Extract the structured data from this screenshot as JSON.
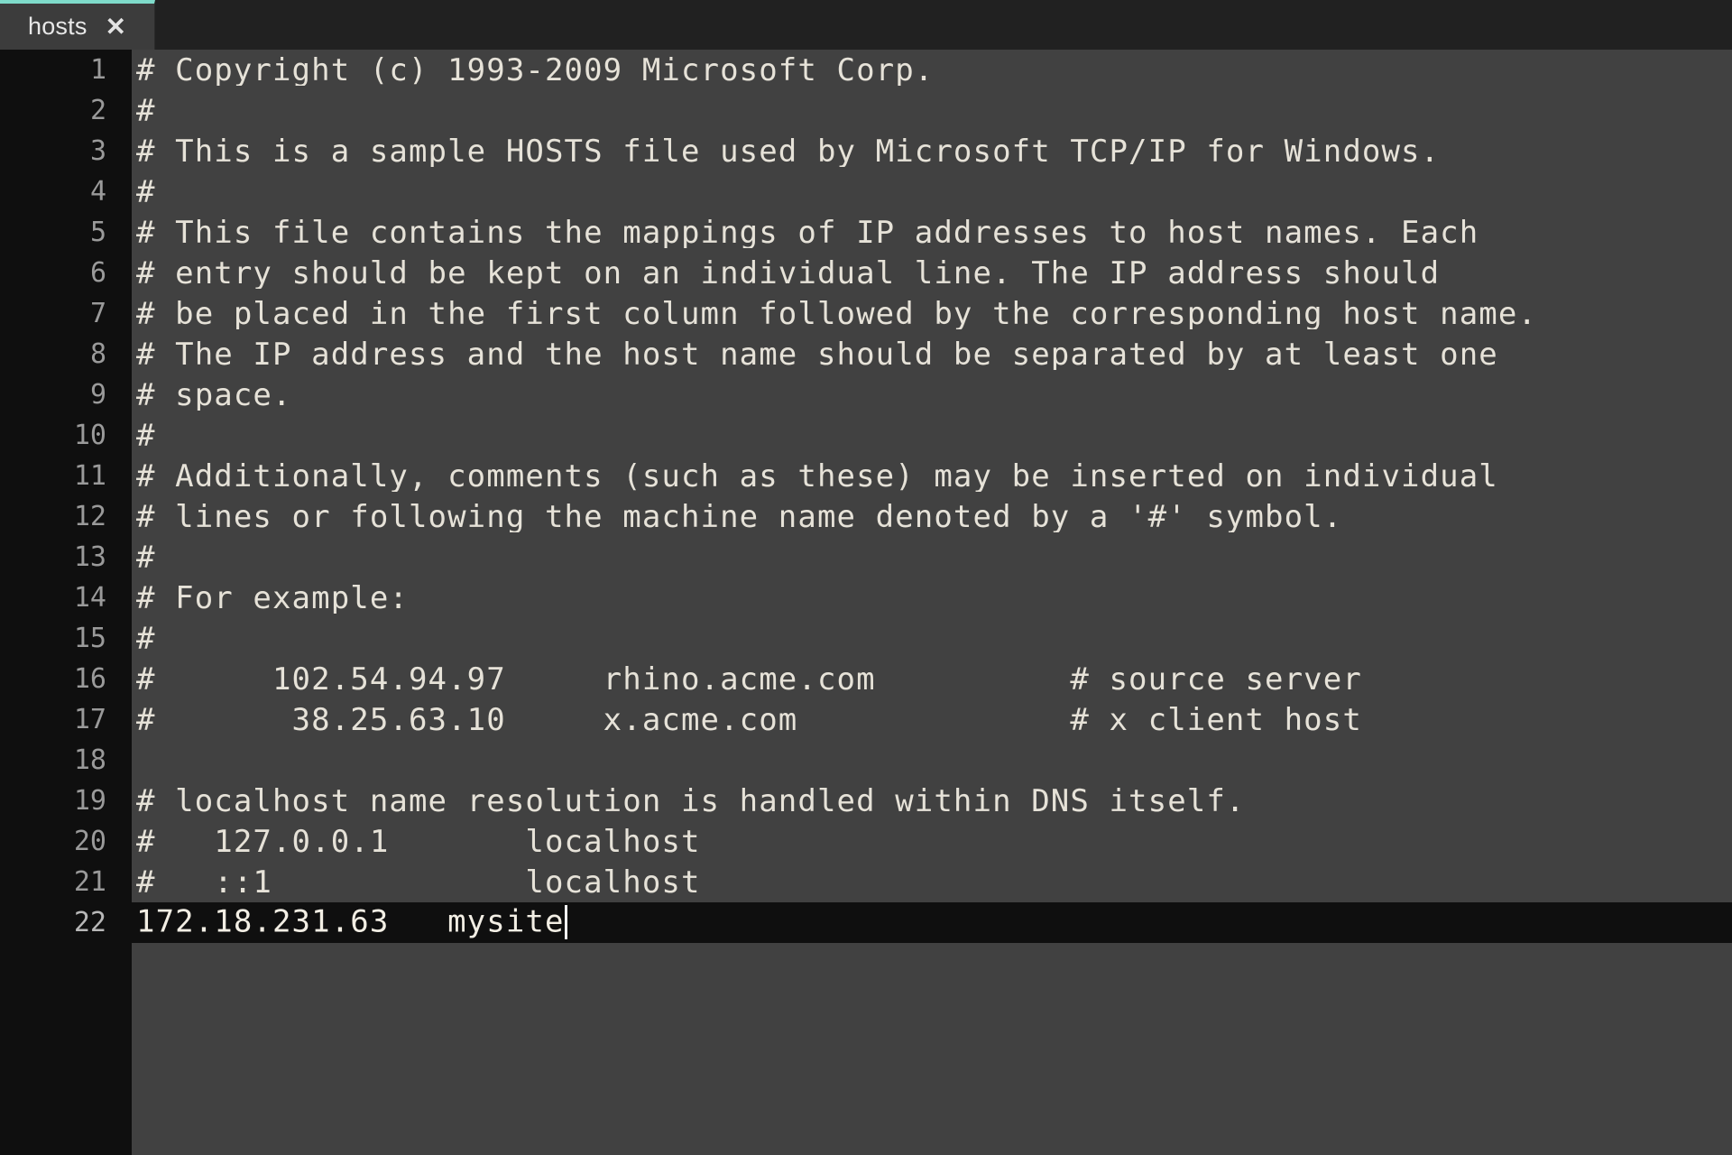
{
  "window": {
    "title": "hosts",
    "colors": {
      "tabbar_background": "#212121",
      "tab_background": "#3c3c3c",
      "tab_accent": "#7fdbca",
      "editor_background": "#414141",
      "gutter_background": "#0f0f0f",
      "text": "#e6e2d8",
      "line_number": "#9a9a9a",
      "caret": "#f3f3f3",
      "active_line_background": "#0f0f0f"
    }
  },
  "tabs": [
    {
      "label": "hosts",
      "close_icon": "close-icon",
      "close_glyph": "✕",
      "active": true
    }
  ],
  "editor": {
    "filename": "hosts",
    "language": "plaintext",
    "cursor": {
      "line": 22,
      "column": 24
    },
    "lines": [
      {
        "number": "1",
        "text": "# Copyright (c) 1993-2009 Microsoft Corp."
      },
      {
        "number": "2",
        "text": "#"
      },
      {
        "number": "3",
        "text": "# This is a sample HOSTS file used by Microsoft TCP/IP for Windows."
      },
      {
        "number": "4",
        "text": "#"
      },
      {
        "number": "5",
        "text": "# This file contains the mappings of IP addresses to host names. Each"
      },
      {
        "number": "6",
        "text": "# entry should be kept on an individual line. The IP address should"
      },
      {
        "number": "7",
        "text": "# be placed in the first column followed by the corresponding host name."
      },
      {
        "number": "8",
        "text": "# The IP address and the host name should be separated by at least one"
      },
      {
        "number": "9",
        "text": "# space."
      },
      {
        "number": "10",
        "text": "#"
      },
      {
        "number": "11",
        "text": "# Additionally, comments (such as these) may be inserted on individual"
      },
      {
        "number": "12",
        "text": "# lines or following the machine name denoted by a '#' symbol."
      },
      {
        "number": "13",
        "text": "#"
      },
      {
        "number": "14",
        "text": "# For example:"
      },
      {
        "number": "15",
        "text": "#"
      },
      {
        "number": "16",
        "text": "#      102.54.94.97     rhino.acme.com          # source server"
      },
      {
        "number": "17",
        "text": "#       38.25.63.10     x.acme.com              # x client host"
      },
      {
        "number": "18",
        "text": ""
      },
      {
        "number": "19",
        "text": "# localhost name resolution is handled within DNS itself."
      },
      {
        "number": "20",
        "text": "#   127.0.0.1       localhost"
      },
      {
        "number": "21",
        "text": "#   ::1             localhost"
      },
      {
        "number": "22",
        "text": "172.18.231.63   mysite",
        "active": true,
        "caret": true
      }
    ]
  }
}
